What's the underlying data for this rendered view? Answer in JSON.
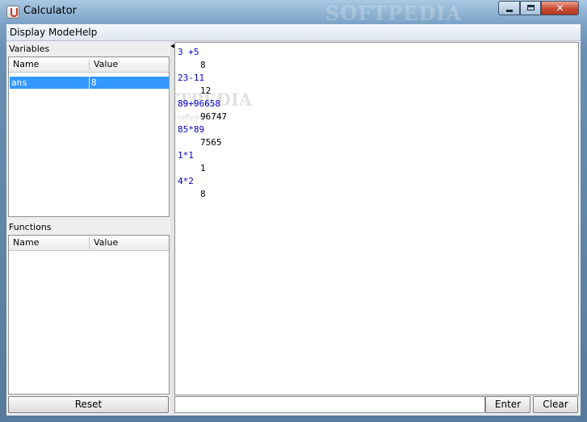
{
  "window": {
    "title": "Calculator",
    "watermark": "SOFTPEDIA",
    "close_glyph": "✕"
  },
  "menu": [
    "Display Mode",
    "Help"
  ],
  "variables": {
    "title": "Variables",
    "columns": [
      "Name",
      "Value"
    ],
    "rows": [
      {
        "name": "ans",
        "value": "8"
      }
    ]
  },
  "functions": {
    "title": "Functions",
    "columns": [
      "Name",
      "Value"
    ],
    "rows": []
  },
  "output": {
    "watermark": "SOFTPEDIA",
    "watermark_sub": "www.softpedia.com",
    "entries": [
      {
        "expr": "3 +5",
        "result": "8"
      },
      {
        "expr": "23-11",
        "result": "12"
      },
      {
        "expr": "89+96658",
        "result": "96747"
      },
      {
        "expr": "85*89",
        "result": "7565"
      },
      {
        "expr": "1*1",
        "result": "1"
      },
      {
        "expr": "4*2",
        "result": "8"
      }
    ]
  },
  "input": {
    "value": ""
  },
  "buttons": {
    "reset": "Reset",
    "enter": "Enter",
    "clear": "Clear"
  },
  "icons": {
    "app": "calculator-java-icon",
    "splitter": "collapse-arrow-icon"
  }
}
